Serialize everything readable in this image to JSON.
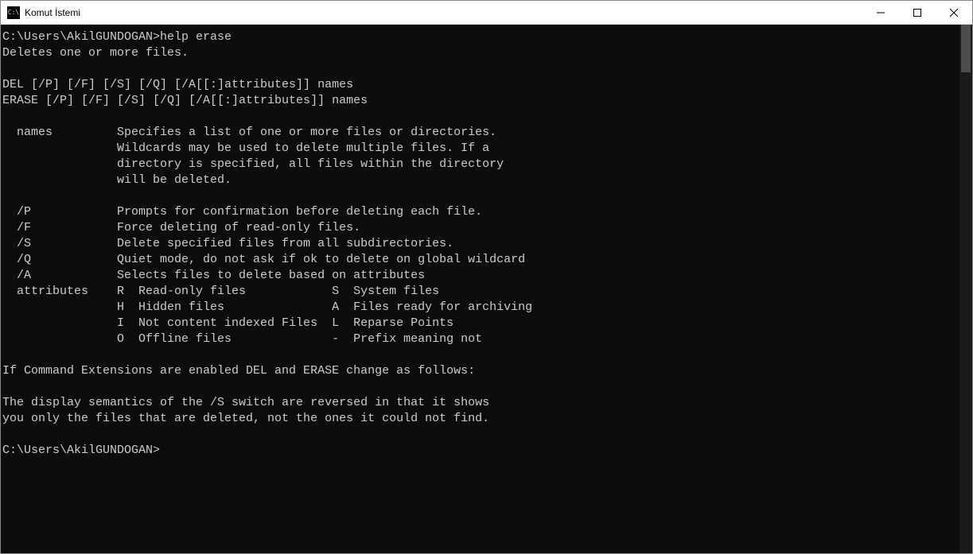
{
  "window": {
    "title": "Komut İstemi",
    "icon_label": "C:\\"
  },
  "terminal": {
    "prompt1_path": "C:\\Users\\AkilGUNDOGAN>",
    "prompt1_cmd": "help erase",
    "line_desc": "Deletes one or more files.",
    "blank": "",
    "syntax1": "DEL [/P] [/F] [/S] [/Q] [/A[[:]attributes]] names",
    "syntax2": "ERASE [/P] [/F] [/S] [/Q] [/A[[:]attributes]] names",
    "names1": "  names         Specifies a list of one or more files or directories.",
    "names2": "                Wildcards may be used to delete multiple files. If a",
    "names3": "                directory is specified, all files within the directory",
    "names4": "                will be deleted.",
    "p": "  /P            Prompts for confirmation before deleting each file.",
    "f": "  /F            Force deleting of read-only files.",
    "s": "  /S            Delete specified files from all subdirectories.",
    "q": "  /Q            Quiet mode, do not ask if ok to delete on global wildcard",
    "a": "  /A            Selects files to delete based on attributes",
    "attr1": "  attributes    R  Read-only files            S  System files",
    "attr2": "                H  Hidden files               A  Files ready for archiving",
    "attr3": "                I  Not content indexed Files  L  Reparse Points",
    "attr4": "                O  Offline files              -  Prefix meaning not",
    "ext1": "If Command Extensions are enabled DEL and ERASE change as follows:",
    "ext2": "The display semantics of the /S switch are reversed in that it shows",
    "ext3": "you only the files that are deleted, not the ones it could not find.",
    "prompt2_path": "C:\\Users\\AkilGUNDOGAN>"
  }
}
